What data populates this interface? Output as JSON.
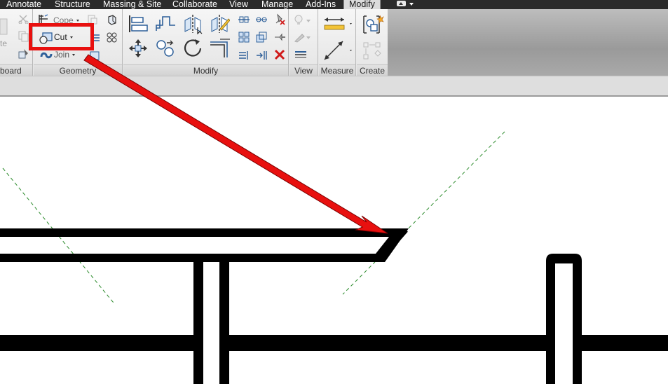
{
  "tabs": [
    {
      "label": "Annotate",
      "active": false
    },
    {
      "label": "Structure",
      "active": false
    },
    {
      "label": "Massing & Site",
      "active": false
    },
    {
      "label": "Collaborate",
      "active": false
    },
    {
      "label": "View",
      "active": false
    },
    {
      "label": "Manage",
      "active": false
    },
    {
      "label": "Add-Ins",
      "active": false
    },
    {
      "label": "Modify",
      "active": true
    }
  ],
  "panels": {
    "clipboard": {
      "label": "board",
      "paste_label": "te"
    },
    "geometry": {
      "label": "Geometry",
      "cope_label": "Cope",
      "cut_label": "Cut",
      "join_label": "Join"
    },
    "modify": {
      "label": "Modify"
    },
    "view": {
      "label": "View"
    },
    "measure": {
      "label": "Measure"
    },
    "create": {
      "label": "Create"
    }
  },
  "icons": {
    "qat": "quick-access-toggle-icon",
    "cut": "cut-geometry-icon",
    "cope": "cope-icon",
    "join": "join-geometry-icon",
    "align": "align-icon",
    "offset": "offset-icon",
    "mirror_axis": "mirror-pick-axis-icon",
    "mirror_draw": "mirror-draw-axis-icon",
    "move": "move-icon",
    "copy": "copy-icon",
    "rotate": "rotate-icon",
    "trim": "trim-extend-icon",
    "split": "split-element-icon",
    "array": "array-icon",
    "scale": "scale-icon",
    "pin": "pin-icon",
    "unpin": "unpin-icon",
    "delete": "delete-icon",
    "measure_between": "measure-between-references-icon",
    "measure_along": "measure-along-element-icon",
    "create_group": "create-group-icon"
  },
  "colors": {
    "annotation_red": "#e8100f",
    "tab_bar": "#2b2b2b",
    "delete_red": "#d01a1a",
    "guide_green": "#2a8a2a"
  }
}
